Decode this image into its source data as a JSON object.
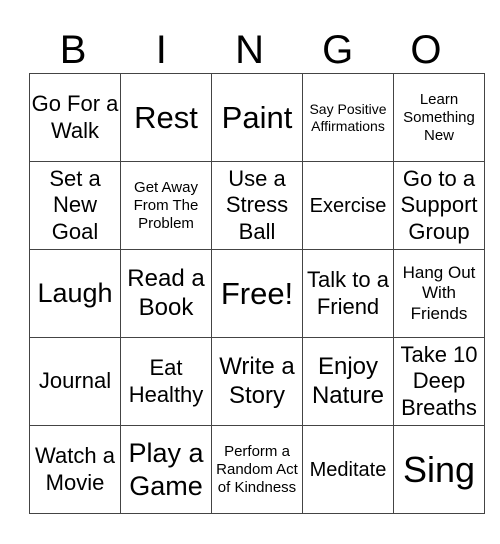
{
  "header": [
    "B",
    "I",
    "N",
    "G",
    "O"
  ],
  "rows": [
    [
      "Go For a Walk",
      "Rest",
      "Paint",
      "Say Positive Affirmations",
      "Learn Something New"
    ],
    [
      "Set a New Goal",
      "Get Away From The Problem",
      "Use a Stress Ball",
      "Exercise",
      "Go to a Support Group"
    ],
    [
      "Laugh",
      "Read a Book",
      "Free!",
      "Talk to a Friend",
      "Hang Out With Friends"
    ],
    [
      "Journal",
      "Eat Healthy",
      "Write a Story",
      "Enjoy Nature",
      "Take 10 Deep Breaths"
    ],
    [
      "Watch a Movie",
      "Play a Game",
      "Perform a Random Act of Kindness",
      "Meditate",
      "Sing"
    ]
  ]
}
